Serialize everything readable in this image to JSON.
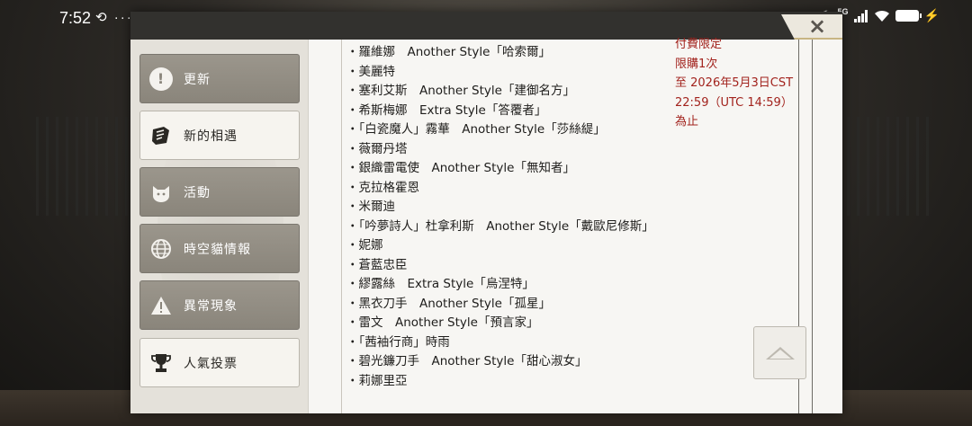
{
  "status_bar": {
    "time": "7:52",
    "left_icons": "⟲ ···",
    "network": "5G"
  },
  "window": {
    "close_label": "×"
  },
  "sidebar": {
    "items": [
      {
        "label": "更新",
        "icon": "exclamation-icon",
        "style": "dark"
      },
      {
        "label": "新的相遇",
        "icon": "scroll-icon",
        "style": "light"
      },
      {
        "label": "活動",
        "icon": "cat-icon",
        "style": "dark"
      },
      {
        "label": "時空貓情報",
        "icon": "globe-icon",
        "style": "dark"
      },
      {
        "label": "異常現象",
        "icon": "warning-icon",
        "style": "dark"
      },
      {
        "label": "人氣投票",
        "icon": "trophy-icon",
        "style": "light"
      }
    ]
  },
  "content": {
    "cut_top_line": "・",
    "list": [
      "・羅維娜　Another Style「哈索爾」",
      "・美麗特",
      "・塞利艾斯　Another Style「建御名方」",
      "・希斯梅娜　Extra Style「答覆者」",
      "・「白瓷魔人」霧華　Another Style「莎絲緹」",
      "・薇爾丹塔",
      "・銀織雷電使　Another Style「無知者」",
      "・克拉格霍恩",
      "・米爾迪",
      "・「吟夢詩人」杜拿利斯　Another Style「戴歐尼修斯」",
      "・妮娜",
      "・蒼藍忠臣",
      "・繆露絲　Extra Style「烏涅特」",
      "・黑衣刀手　Another Style「孤星」",
      "・雷文　Another Style「預言家」",
      "・「茜袖行商」時雨",
      "・碧光鐮刀手　Another Style「甜心淑女」",
      "・莉娜里亞"
    ]
  },
  "info": {
    "lines": [
      "付費限定",
      "限購1次",
      "至 2026年5月3日CST",
      "22:59（UTC 14:59）",
      "為止"
    ]
  }
}
